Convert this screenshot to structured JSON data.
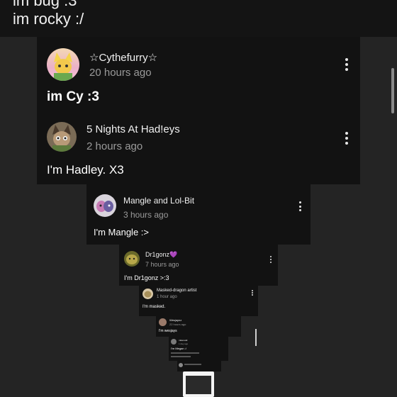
{
  "top_lines": [
    "im bug :3",
    "im rocky :/"
  ],
  "colors": {
    "background": "#242424",
    "card_background": "#121212",
    "timestamp": "#9a9a9a"
  },
  "comments": [
    {
      "author": "☆Cythefurry☆",
      "time": "20 hours ago",
      "text": "im Cy :3",
      "avatar_icon": "furry-avatar-icon"
    },
    {
      "author": "5 Nights At Had!eys",
      "time": "2 hours ago",
      "text": "I'm Hadley. X3",
      "avatar_icon": "hadley-avatar-icon"
    },
    {
      "author": "Mangle and Lol-Bit",
      "time": "3 hours ago",
      "text": "I'm Mangle :>",
      "avatar_icon": "mangle-avatar-icon"
    },
    {
      "author": "Dr1gonz💜",
      "time": "7 hours ago",
      "text": "I'm Dr1gonz >:3",
      "avatar_icon": "drigonz-avatar-icon"
    },
    {
      "author": "Masked-dragon artist",
      "time": "1 hour ago",
      "text": "I'm masked.",
      "avatar_icon": "masked-avatar-icon"
    },
    {
      "author": "Wesjaynz",
      "time": "22 hours ago",
      "text": "I'm wesjays",
      "avatar_icon": "wes-avatar-icon"
    },
    {
      "author": "mikeredd",
      "time": "1 day ago",
      "text": "I'm Megan :/",
      "avatar_icon": "mike-avatar-icon"
    },
    {
      "author": "",
      "time": "",
      "text": "",
      "avatar_icon": "small-avatar-icon"
    }
  ]
}
